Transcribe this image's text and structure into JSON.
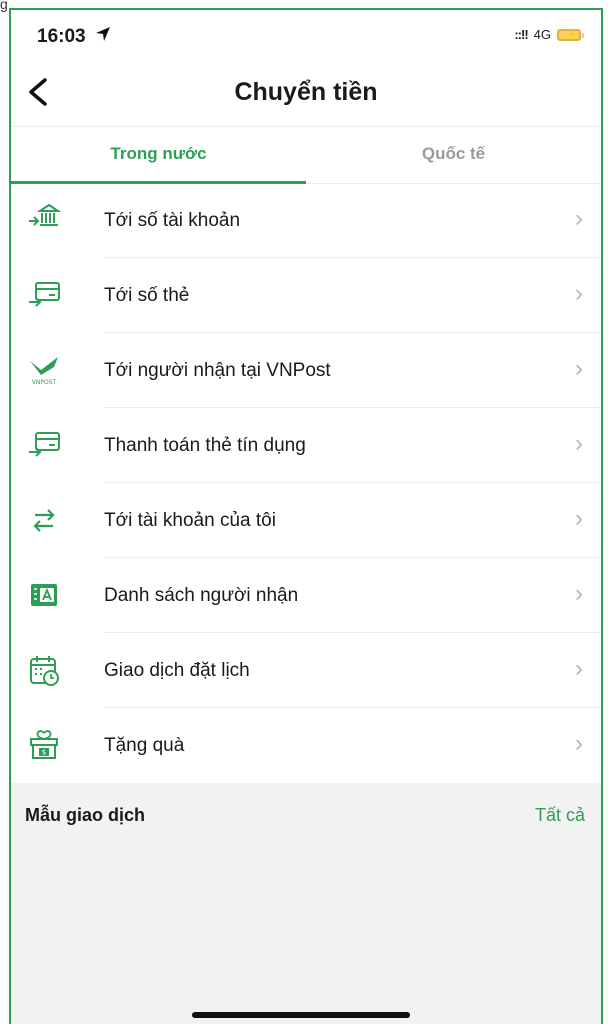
{
  "status_bar": {
    "time": "16:03",
    "signal": "::!!",
    "network": "4G"
  },
  "header": {
    "title": "Chuyển tiền"
  },
  "tabs": [
    {
      "label": "Trong nước",
      "active": true
    },
    {
      "label": "Quốc tế",
      "active": false
    }
  ],
  "menu": [
    {
      "label": "Tới số tài khoản",
      "icon": "bank-transfer-icon"
    },
    {
      "label": "Tới số thẻ",
      "icon": "card-transfer-icon"
    },
    {
      "label": "Tới người nhận tại VNPost",
      "icon": "vnpost-icon",
      "icon_text": "VNPOST"
    },
    {
      "label": "Thanh toán thẻ tín dụng",
      "icon": "credit-card-payment-icon"
    },
    {
      "label": "Tới tài khoản của tôi",
      "icon": "swap-arrows-icon"
    },
    {
      "label": "Danh sách người nhận",
      "icon": "contact-card-icon"
    },
    {
      "label": "Giao dịch đặt lịch",
      "icon": "calendar-clock-icon"
    },
    {
      "label": "Tặng quà",
      "icon": "gift-icon"
    }
  ],
  "templates": {
    "title": "Mẫu giao dịch",
    "see_all": "Tất cả"
  },
  "colors": {
    "accent": "#2e9e57",
    "divider": "#ececec",
    "chevron": "#b5b5b5"
  }
}
